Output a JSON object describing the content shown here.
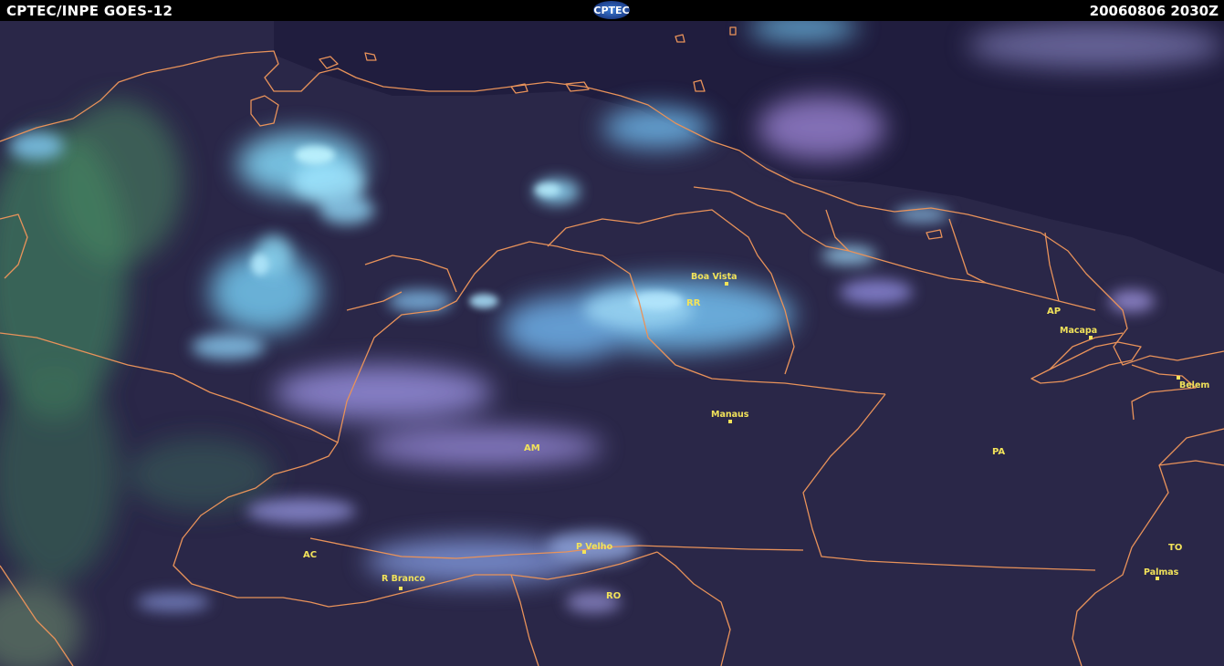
{
  "header": {
    "left_title": "CPTEC/INPE  GOES-12",
    "logo_text": "CPTEC",
    "timestamp": "20060806 2030Z"
  },
  "map": {
    "cities": [
      {
        "name": "Boa Vista"
      },
      {
        "name": "Manaus"
      },
      {
        "name": "Macapa"
      },
      {
        "name": "Belem"
      },
      {
        "name": "P Velho"
      },
      {
        "name": "R Branco"
      },
      {
        "name": "Palmas"
      }
    ],
    "states": [
      "RR",
      "AP",
      "AM",
      "PA",
      "AC",
      "RO",
      "TO"
    ],
    "colors": {
      "background": "#2a2748",
      "border_lines": "#e8925a",
      "labels": "#f2e35a",
      "cloud_cyan": "#5fb7e0",
      "cloud_lilac": "#8a7fc0",
      "vegetation_green": "#4f9a6a"
    }
  }
}
